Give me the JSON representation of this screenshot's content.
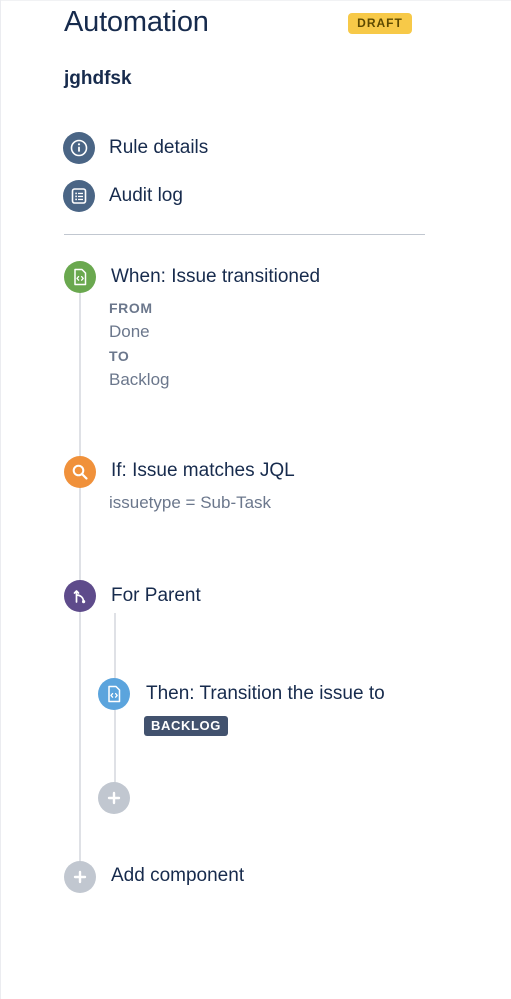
{
  "header": {
    "title": "Automation",
    "status_badge": "DRAFT",
    "rule_name": "jghdfsk"
  },
  "nav": {
    "rule_details": "Rule details",
    "audit_log": "Audit log"
  },
  "trigger": {
    "title": "When: Issue transitioned",
    "from_label": "FROM",
    "from_value": "Done",
    "to_label": "TO",
    "to_value": "Backlog"
  },
  "condition": {
    "title": "If: Issue matches JQL",
    "jql": "issuetype = Sub-Task"
  },
  "branch": {
    "title": "For Parent",
    "action": {
      "title": "Then: Transition the issue to",
      "status": "BACKLOG"
    }
  },
  "footer": {
    "add_component": "Add component"
  },
  "colors": {
    "draft_badge": "#f7c948",
    "nav_icon": "#4a6585",
    "trigger": "#6aa84f",
    "condition": "#f0913b",
    "branch": "#5e4b8b",
    "action": "#5ba4dd",
    "status_lozenge": "#42526e",
    "add": "#c1c7d0"
  },
  "icons": {
    "rule_details": "info-icon",
    "audit_log": "list-icon",
    "trigger": "document-code-icon",
    "condition": "search-icon",
    "branch": "branch-icon",
    "action": "document-code-icon",
    "add": "plus-icon"
  }
}
